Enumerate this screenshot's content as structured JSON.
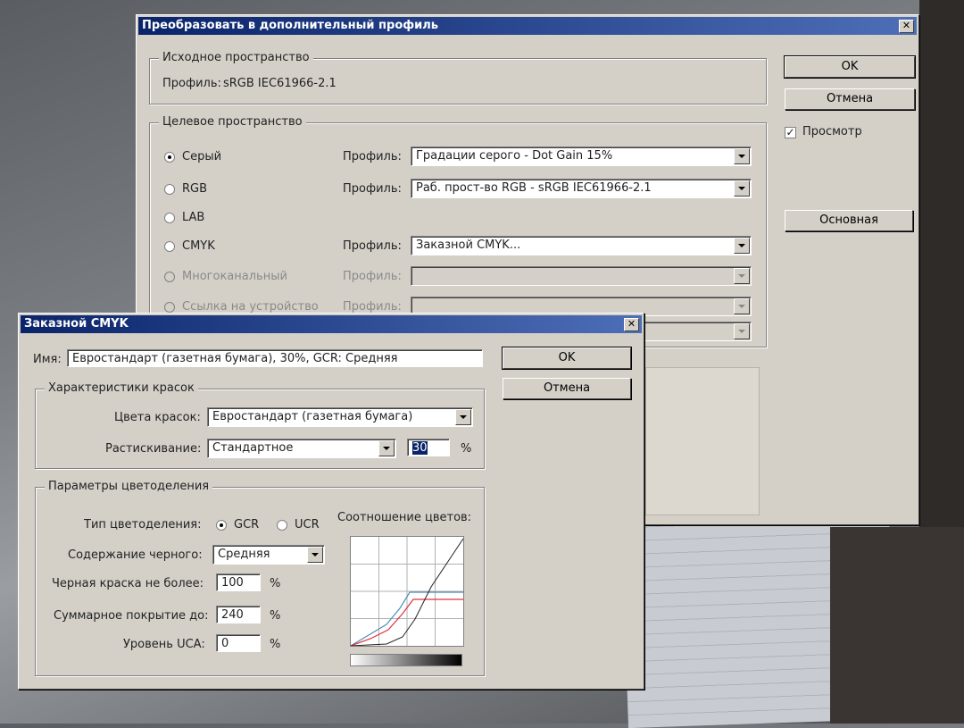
{
  "main_dialog": {
    "title": "Преобразовать в дополнительный профиль",
    "source": {
      "group_title": "Исходное пространство",
      "profile_label": "Профиль:",
      "profile_value": "sRGB IEC61966-2.1"
    },
    "target": {
      "group_title": "Целевое пространство",
      "modes": [
        {
          "label": "Серый",
          "selected": true,
          "enabled": true
        },
        {
          "label": "RGB",
          "selected": false,
          "enabled": true
        },
        {
          "label": "LAB",
          "selected": false,
          "enabled": true
        },
        {
          "label": "CMYK",
          "selected": false,
          "enabled": true
        },
        {
          "label": "Многоканальный",
          "selected": false,
          "enabled": false
        },
        {
          "label": "Ссылка на устройство",
          "selected": false,
          "enabled": false
        }
      ],
      "profile_label": "Профиль:",
      "profiles": [
        {
          "value": "Градации серого - Dot Gain 15%",
          "enabled": true
        },
        {
          "value": "Раб. прост-во RGB - sRGB IEC61966-2.1",
          "enabled": true
        },
        {
          "value": "Заказной CMYK...",
          "enabled": true
        },
        {
          "value": "",
          "enabled": false
        },
        {
          "value": "",
          "enabled": false
        },
        {
          "value": "",
          "enabled": false
        }
      ]
    },
    "ok_label": "OK",
    "cancel_label": "Отмена",
    "preview_label": "Просмотр",
    "preview_checked": true,
    "basic_label": "Основная"
  },
  "cmyk_dialog": {
    "title": "Заказной CMYK",
    "name_label": "Имя:",
    "name_value": "Евростандарт (газетная бумага), 30%, GCR: Средняя",
    "ok_label": "OK",
    "cancel_label": "Отмена",
    "ink": {
      "group_title": "Характеристики красок",
      "colors_label": "Цвета красок:",
      "colors_value": "Евростандарт (газетная бумага)",
      "gain_label": "Растискивание:",
      "gain_value": "Стандартное",
      "gain_amount": "30",
      "gain_unit": "%"
    },
    "separation": {
      "group_title": "Параметры цветоделения",
      "type_label": "Тип цветоделения:",
      "type_options": [
        {
          "label": "GCR",
          "selected": true
        },
        {
          "label": "UCR",
          "selected": false
        }
      ],
      "black_gen_label": "Содержание черного:",
      "black_gen_value": "Средняя",
      "black_limit_label": "Черная краска не более:",
      "black_limit_value": "100",
      "total_limit_label": "Суммарное покрытие до:",
      "total_limit_value": "240",
      "uca_label": "Уровень UCA:",
      "uca_value": "0",
      "percent": "%",
      "graph_label": "Соотношение цветов:"
    }
  },
  "colors": {
    "titlebar_start": "#0a246a",
    "titlebar_end": "#4d6fb8",
    "dialog_bg": "#d4d0c8",
    "curve_cyan": "#4f8fb8",
    "curve_magenta": "#e0303a",
    "curve_black": "#222222"
  }
}
